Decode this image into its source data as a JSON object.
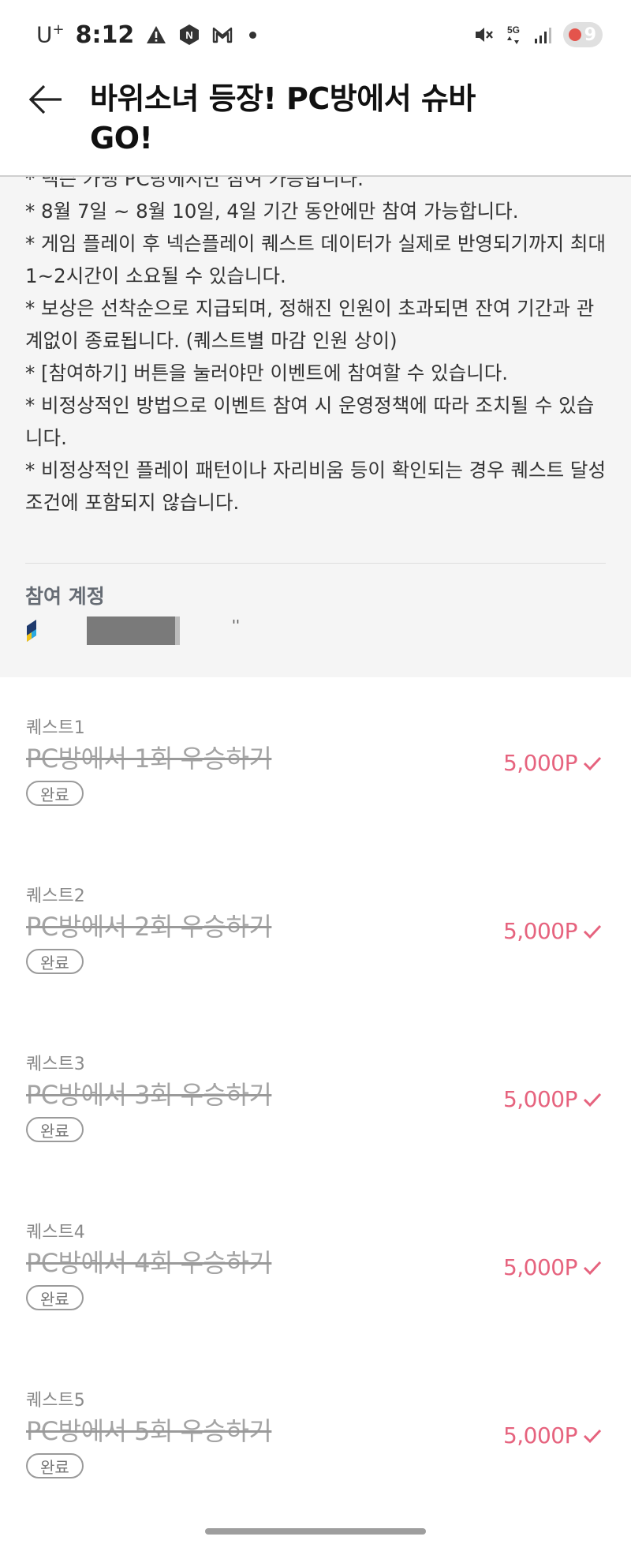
{
  "status_bar": {
    "carrier": "U",
    "carrier_sup": "+",
    "time": "8:12",
    "battery": "9",
    "icons_left": [
      "warning-icon",
      "n-app-icon",
      "gmail-icon",
      "notification-dot-icon"
    ],
    "icons_right": [
      "mute-icon",
      "5g-icon",
      "signal-icon",
      "battery-icon"
    ]
  },
  "header": {
    "title": "바위소녀 등장! PC방에서 슈바 GO!"
  },
  "notice": {
    "lines": [
      "* 넥슨 가맹 PC방에서만 참여 가능합니다.",
      "* 8월 7일 ~ 8월 10일, 4일 기간 동안에만 참여 가능합니다.",
      "* 게임 플레이 후 넥슨플레이 퀘스트 데이터가 실제로 반영되기까지 최대 1~2시간이 소요될 수 있습니다.",
      "* 보상은 선착순으로 지급되며, 정해진 인원이 초과되면 잔여 기간과 관계없이 종료됩니다. (퀘스트별 마감 인원 상이)",
      "* [참여하기] 버튼을 눌러야만 이벤트에 참여할 수 있습니다.",
      "* 비정상적인 방법으로 이벤트 참여 시 운영정책에 따라 조치될 수 있습니다.",
      "* 비정상적인 플레이 패턴이나 자리비움 등이 확인되는 경우 퀘스트 달성 조건에 포함되지 않습니다."
    ]
  },
  "account": {
    "label": "참여 계정",
    "suffix": "''"
  },
  "quests": [
    {
      "label": "퀘스트1",
      "title": "PC방에서 1회 우승하기",
      "status": "완료",
      "points": "5,000P"
    },
    {
      "label": "퀘스트2",
      "title": "PC방에서 2회 우승하기",
      "status": "완료",
      "points": "5,000P"
    },
    {
      "label": "퀘스트3",
      "title": "PC방에서 3회 우승하기",
      "status": "완료",
      "points": "5,000P"
    },
    {
      "label": "퀘스트4",
      "title": "PC방에서 4회 우승하기",
      "status": "완료",
      "points": "5,000P"
    },
    {
      "label": "퀘스트5",
      "title": "PC방에서 5회 우승하기",
      "status": "완료",
      "points": "5,000P"
    }
  ],
  "colors": {
    "accent": "#e6637e",
    "completed_text": "#a4a4a4",
    "notice_bg": "#f5f5f5"
  }
}
